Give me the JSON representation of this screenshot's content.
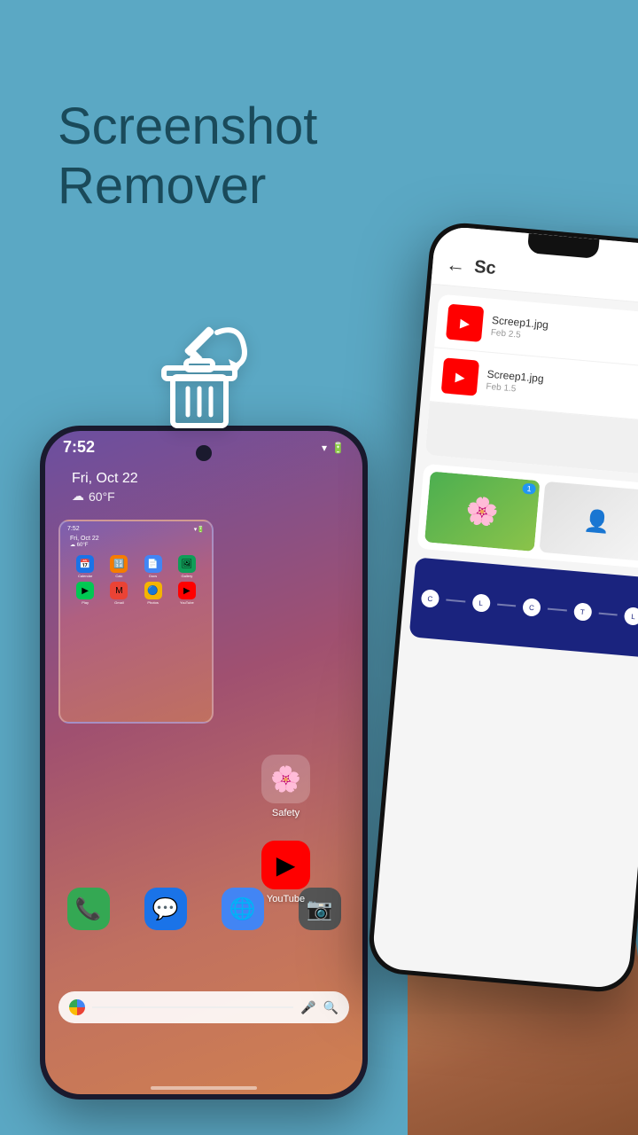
{
  "background_color": "#5ba8c4",
  "title": {
    "line1": "Screenshot",
    "line2": "Remover"
  },
  "left_phone": {
    "time": "7:52",
    "date": "Fri, Oct 22",
    "weather": "60°F",
    "apps": [
      {
        "label": "Calendar",
        "emoji": "📅",
        "bg": "#1a73e8"
      },
      {
        "label": "Calculator",
        "emoji": "🔢",
        "bg": "#f57c00"
      },
      {
        "label": "Docs",
        "emoji": "📄",
        "bg": "#4285f4"
      },
      {
        "label": "Gallery",
        "emoji": "🖼️",
        "bg": "#0f9d58"
      },
      {
        "label": "Play Store",
        "emoji": "▶",
        "bg": "#00c853"
      },
      {
        "label": "Gmail",
        "emoji": "✉",
        "bg": "#ea4335"
      },
      {
        "label": "Photos",
        "emoji": "🔵",
        "bg": "#f4b400"
      },
      {
        "label": "YouTube",
        "emoji": "▶",
        "bg": "#ff0000"
      }
    ],
    "dock_apps": [
      {
        "label": "Phone",
        "emoji": "📞",
        "bg": "#34a853"
      },
      {
        "label": "Messages",
        "emoji": "💬",
        "bg": "#1a73e8"
      },
      {
        "label": "Chrome",
        "emoji": "🌐",
        "bg": "#4285f4"
      },
      {
        "label": "Camera",
        "emoji": "📷",
        "bg": "#666"
      }
    ]
  },
  "right_phone": {
    "header_title": "Sc",
    "back_label": "←",
    "screenshots": [
      {
        "name": "Screep1.jpg",
        "date": "Feb 2.5",
        "app": "youtube"
      },
      {
        "name": "Screep1.jpg",
        "date": "Feb 1.5",
        "app": "youtube"
      }
    ],
    "chart_nodes": [
      "C",
      "L",
      "C",
      "T",
      "L"
    ]
  },
  "outside_apps": [
    {
      "label": "Safety",
      "emoji": "🌸"
    },
    {
      "label": "YouTube",
      "emoji": "▶"
    }
  ],
  "trash_icon": {
    "color": "white",
    "description": "delete screenshot icon"
  }
}
